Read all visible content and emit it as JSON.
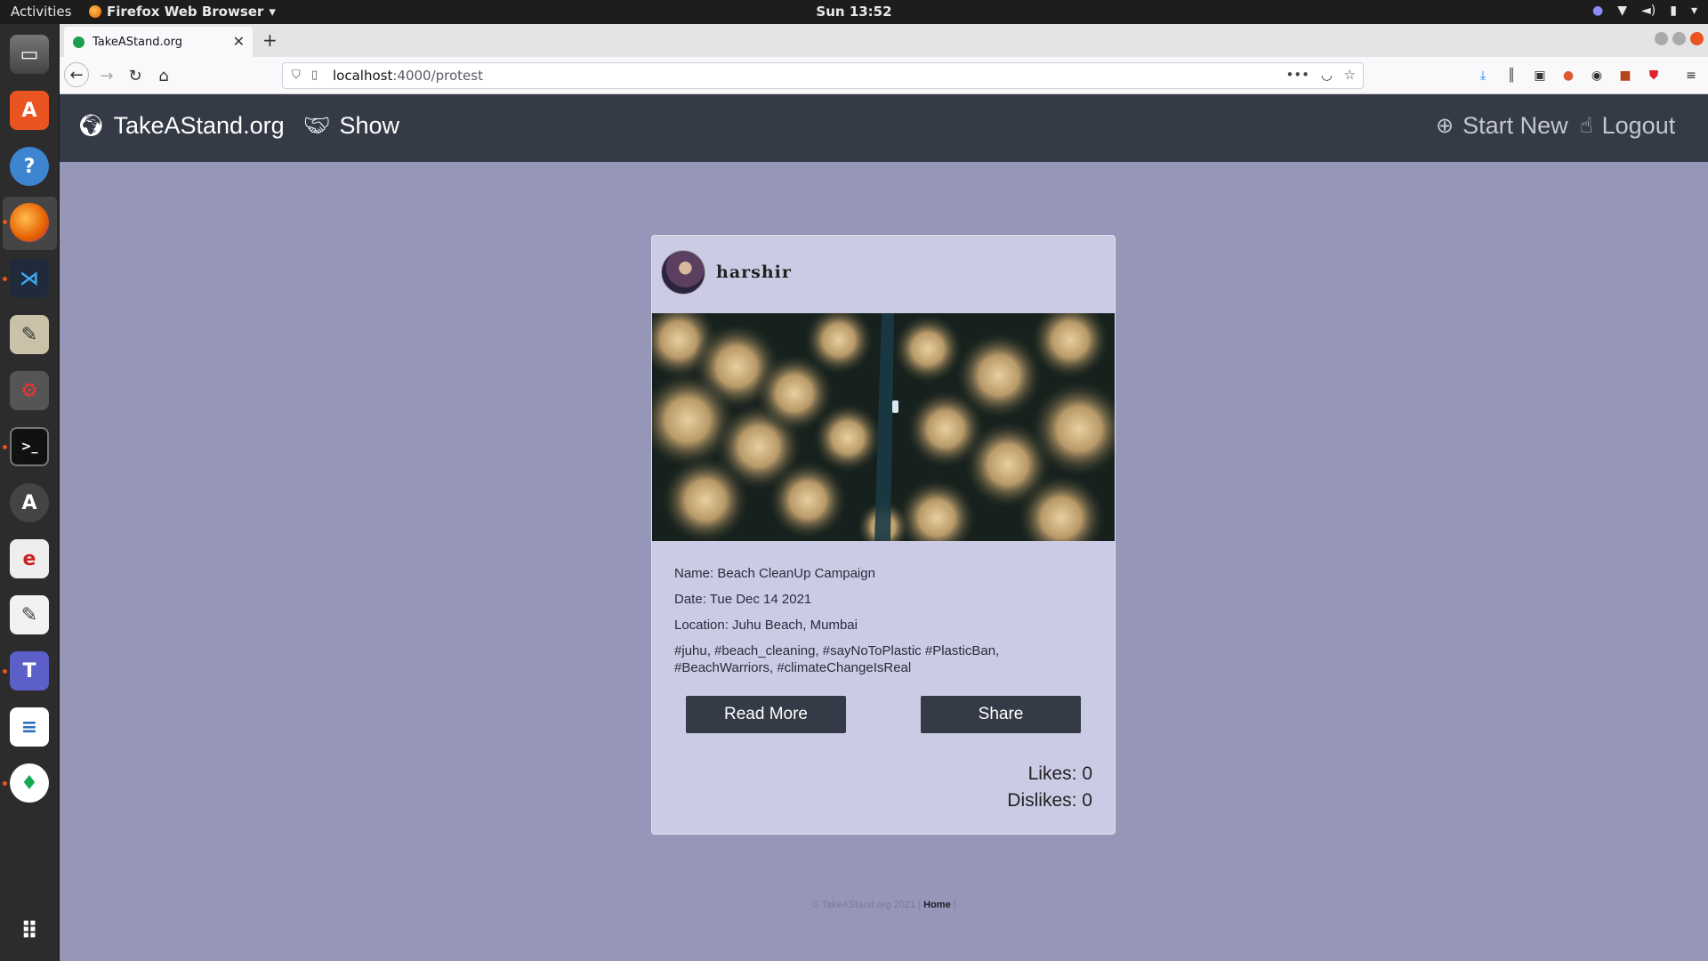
{
  "os": {
    "activities": "Activities",
    "app_menu": "Firefox Web Browser",
    "clock": "Sun 13:52"
  },
  "browser": {
    "tab_title": "TakeAStand.org",
    "url_host": "localhost",
    "url_path": ":4000/protest"
  },
  "site": {
    "brand": "TakeAStand.org",
    "nav_show": "Show",
    "nav_start_new": "Start New",
    "nav_logout": "Logout"
  },
  "card": {
    "username": "harshir",
    "name_line": "Name: Beach CleanUp Campaign",
    "date_line": "Date: Tue Dec 14 2021",
    "location_line": "Location: Juhu Beach, Mumbai",
    "tags_line1": "#juhu, #beach_cleaning, #sayNoToPlastic #PlasticBan,",
    "tags_line2": "#BeachWarriors, #climateChangeIsReal",
    "read_more": "Read More",
    "share": "Share",
    "likes": "Likes: 0",
    "dislikes": "Dislikes: 0"
  },
  "footer": {
    "copyright": "© TakeAStand.org 2021 |",
    "home": "Home",
    "sep": "|"
  },
  "colors": {
    "page_bg": "#9696b8",
    "nav_bg": "#343a46",
    "card_bg": "#cccbe6",
    "button_bg": "#343a46"
  }
}
